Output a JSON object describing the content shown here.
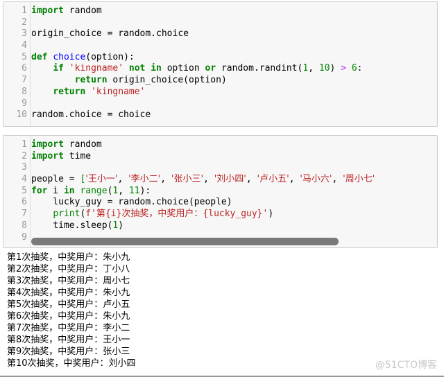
{
  "cell1": {
    "lines": [
      {
        "n": "1",
        "tokens": [
          {
            "t": "import",
            "c": "kw"
          },
          {
            "t": " random",
            "c": ""
          }
        ]
      },
      {
        "n": "2",
        "tokens": []
      },
      {
        "n": "3",
        "tokens": [
          {
            "t": "origin_choice = random.choice",
            "c": ""
          }
        ]
      },
      {
        "n": "4",
        "tokens": []
      },
      {
        "n": "5",
        "tokens": [
          {
            "t": "def",
            "c": "kw"
          },
          {
            "t": " ",
            "c": ""
          },
          {
            "t": "choice",
            "c": "def"
          },
          {
            "t": "(option):",
            "c": ""
          }
        ]
      },
      {
        "n": "6",
        "tokens": [
          {
            "t": "    ",
            "c": ""
          },
          {
            "t": "if",
            "c": "kw"
          },
          {
            "t": " ",
            "c": ""
          },
          {
            "t": "'kingname'",
            "c": "str"
          },
          {
            "t": " ",
            "c": ""
          },
          {
            "t": "not in",
            "c": "kw"
          },
          {
            "t": " option ",
            "c": ""
          },
          {
            "t": "or",
            "c": "kw"
          },
          {
            "t": " random.randint(",
            "c": ""
          },
          {
            "t": "1",
            "c": "num"
          },
          {
            "t": ", ",
            "c": ""
          },
          {
            "t": "10",
            "c": "num"
          },
          {
            "t": ") ",
            "c": ""
          },
          {
            "t": ">",
            "c": "op"
          },
          {
            "t": " ",
            "c": ""
          },
          {
            "t": "6",
            "c": "num"
          },
          {
            "t": ":",
            "c": ""
          }
        ]
      },
      {
        "n": "7",
        "tokens": [
          {
            "t": "        ",
            "c": ""
          },
          {
            "t": "return",
            "c": "kw"
          },
          {
            "t": " origin_choice(option)",
            "c": ""
          }
        ]
      },
      {
        "n": "8",
        "tokens": [
          {
            "t": "    ",
            "c": ""
          },
          {
            "t": "return",
            "c": "kw"
          },
          {
            "t": " ",
            "c": ""
          },
          {
            "t": "'kingname'",
            "c": "str"
          }
        ]
      },
      {
        "n": "9",
        "tokens": []
      },
      {
        "n": "10",
        "tokens": [
          {
            "t": "random.choice = choice",
            "c": ""
          }
        ]
      }
    ]
  },
  "cell2": {
    "lines": [
      {
        "n": "1",
        "tokens": [
          {
            "t": "import",
            "c": "kw"
          },
          {
            "t": " random",
            "c": ""
          }
        ]
      },
      {
        "n": "2",
        "tokens": [
          {
            "t": "import",
            "c": "kw"
          },
          {
            "t": " time",
            "c": ""
          }
        ]
      },
      {
        "n": "3",
        "tokens": []
      },
      {
        "n": "4",
        "tokens": [
          {
            "t": "people = ",
            "c": ""
          },
          {
            "t": "[",
            "c": "br"
          },
          {
            "t": "'王小一'",
            "c": "str cjk"
          },
          {
            "t": ", ",
            "c": ""
          },
          {
            "t": "'李小二'",
            "c": "str cjk"
          },
          {
            "t": ", ",
            "c": ""
          },
          {
            "t": "'张小三'",
            "c": "str cjk"
          },
          {
            "t": ", ",
            "c": ""
          },
          {
            "t": "'刘小四'",
            "c": "str cjk"
          },
          {
            "t": ", ",
            "c": ""
          },
          {
            "t": "'卢小五'",
            "c": "str cjk"
          },
          {
            "t": ", ",
            "c": ""
          },
          {
            "t": "'马小六'",
            "c": "str cjk"
          },
          {
            "t": ", ",
            "c": ""
          },
          {
            "t": "'周小七'",
            "c": "str cjk"
          }
        ]
      },
      {
        "n": "5",
        "tokens": [
          {
            "t": "for",
            "c": "kw"
          },
          {
            "t": " i ",
            "c": ""
          },
          {
            "t": "in",
            "c": "kw"
          },
          {
            "t": " ",
            "c": ""
          },
          {
            "t": "range",
            "c": "bi"
          },
          {
            "t": "(",
            "c": ""
          },
          {
            "t": "1",
            "c": "num"
          },
          {
            "t": ", ",
            "c": ""
          },
          {
            "t": "11",
            "c": "num"
          },
          {
            "t": "):",
            "c": ""
          }
        ]
      },
      {
        "n": "6",
        "tokens": [
          {
            "t": "    lucky_guy = random.choice(people)",
            "c": ""
          }
        ]
      },
      {
        "n": "7",
        "tokens": [
          {
            "t": "    ",
            "c": ""
          },
          {
            "t": "print",
            "c": "bi"
          },
          {
            "t": "(",
            "c": ""
          },
          {
            "t": "f'第{i}次抽奖，中奖用户：{lucky_guy}'",
            "c": "str"
          },
          {
            "t": ")",
            "c": ""
          }
        ]
      },
      {
        "n": "8",
        "tokens": [
          {
            "t": "    time.sleep(",
            "c": ""
          },
          {
            "t": "1",
            "c": "num"
          },
          {
            "t": ")",
            "c": ""
          }
        ]
      },
      {
        "n": "9",
        "tokens": []
      }
    ],
    "scrollbar_visible_fraction": 0.76
  },
  "output": {
    "lines": [
      "第1次抽奖，中奖用户：朱小九",
      "第2次抽奖，中奖用户：丁小八",
      "第3次抽奖，中奖用户：周小七",
      "第4次抽奖，中奖用户：朱小九",
      "第5次抽奖，中奖用户：卢小五",
      "第6次抽奖，中奖用户：朱小九",
      "第7次抽奖，中奖用户：李小二",
      "第8次抽奖，中奖用户：王小一",
      "第9次抽奖，中奖用户：张小三",
      "第10次抽奖，中奖用户：刘小四"
    ]
  },
  "watermark": "@51CTO博客"
}
